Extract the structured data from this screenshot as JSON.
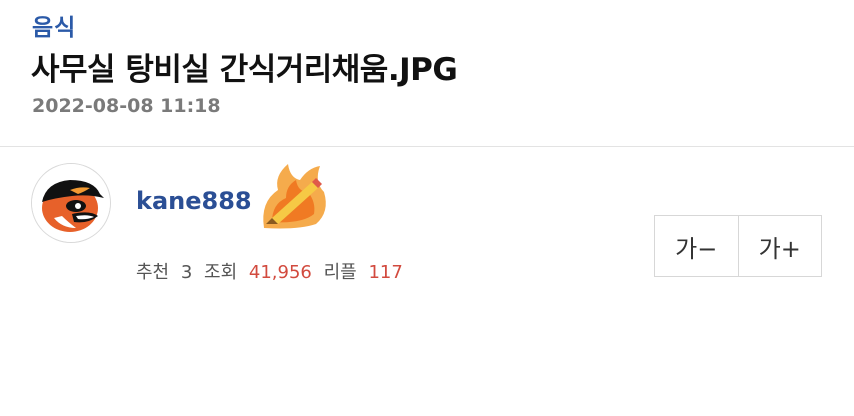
{
  "post": {
    "category": "음식",
    "title": "사무실 탕비실 간식거리채움.JPG",
    "date": "2022-08-08 11:18"
  },
  "author": {
    "name": "kane888",
    "avatar_icon": "orioles-bird-icon",
    "badge_icon": "flaming-pencil-icon"
  },
  "stats": {
    "recommend_label": "추천",
    "recommend_value": "3",
    "views_label": "조회",
    "views_value": "41,956",
    "replies_label": "리플",
    "replies_value": "117"
  },
  "font_controls": {
    "decrease_label": "가−",
    "increase_label": "가+"
  },
  "colors": {
    "category": "#2b5aa8",
    "author": "#2b4f95",
    "stat_number": "#d24a3e"
  }
}
